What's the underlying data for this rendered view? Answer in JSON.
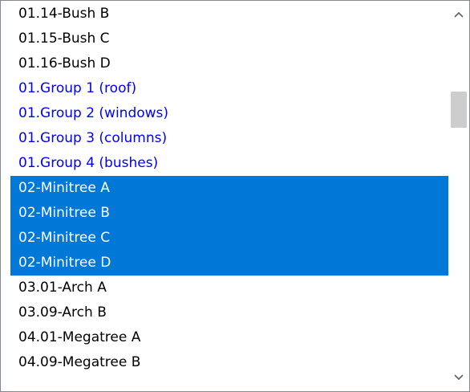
{
  "listbox": {
    "items": [
      {
        "label": "01.14-Bush B",
        "kind": "normal"
      },
      {
        "label": "01.15-Bush C",
        "kind": "normal"
      },
      {
        "label": "01.16-Bush D",
        "kind": "normal"
      },
      {
        "label": "01.Group 1 (roof)",
        "kind": "group"
      },
      {
        "label": "01.Group 2 (windows)",
        "kind": "group"
      },
      {
        "label": "01.Group 3 (columns)",
        "kind": "group"
      },
      {
        "label": "01.Group 4 (bushes)",
        "kind": "group"
      },
      {
        "label": "02-Minitree A",
        "kind": "selected"
      },
      {
        "label": "02-Minitree B",
        "kind": "selected"
      },
      {
        "label": "02-Minitree C",
        "kind": "selected"
      },
      {
        "label": "02-Minitree D",
        "kind": "selected"
      },
      {
        "label": "03.01-Arch A",
        "kind": "normal"
      },
      {
        "label": "03.09-Arch B",
        "kind": "normal"
      },
      {
        "label": "04.01-Megatree A",
        "kind": "normal"
      },
      {
        "label": "04.09-Megatree B",
        "kind": "normal"
      }
    ]
  },
  "scrollbar": {
    "up_icon": "chevron-up-icon",
    "down_icon": "chevron-down-icon"
  },
  "colors": {
    "group_text": "#0000ff",
    "selection_background": "#0078d7",
    "selection_text": "#ffffff",
    "border": "#828790",
    "thumb": "#cdcdcd"
  }
}
